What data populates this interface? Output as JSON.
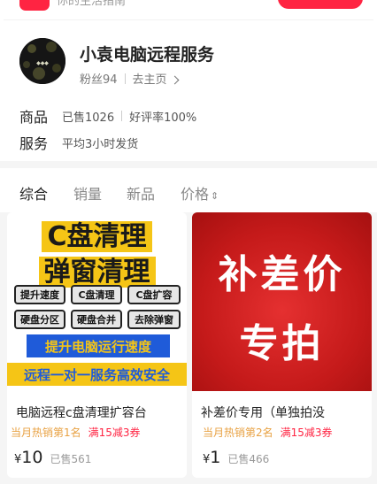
{
  "header": {
    "app_subtitle": "你的生活指南"
  },
  "shop": {
    "name": "小袁电脑远程服务",
    "fans": "粉丝94",
    "home_link": "去主页",
    "rows": [
      {
        "label": "商品",
        "items": [
          "已售1026",
          "好评率100%"
        ]
      },
      {
        "label": "服务",
        "items": [
          "平均3小时发货"
        ]
      }
    ]
  },
  "sort_tabs": [
    {
      "label": "综合",
      "active": true
    },
    {
      "label": "销量",
      "active": false
    },
    {
      "label": "新品",
      "active": false
    },
    {
      "label": "价格",
      "active": false,
      "icon": "sort-updown-icon"
    }
  ],
  "products": [
    {
      "image_text": {
        "line1": "C盘清理",
        "line2": "弹窗清理",
        "pills": [
          "提升速度",
          "C盘清理",
          "C盘扩容",
          "硬盘分区",
          "硬盘合并",
          "去除弹窗"
        ],
        "banner1": "提升电脑运行速度",
        "banner2": "远程一对一服务高效安全"
      },
      "title": "电脑远程c盘清理扩容台",
      "hot_tag": "当月热销第1名",
      "coupon": "满15减3券",
      "currency": "¥",
      "price": "10",
      "sold": "已售561"
    },
    {
      "image_text": {
        "line1": "补差价",
        "line2": "专拍"
      },
      "title": "补差价专用（单独拍没",
      "hot_tag": "当月热销第2名",
      "coupon": "满15减3券",
      "currency": "¥",
      "price": "1",
      "sold": "已售466"
    }
  ],
  "colors": {
    "brand_red": "#ff2442",
    "hot_orange": "#e8a142",
    "banner_blue": "#1f5bd9",
    "banner_yellow": "#f5c516"
  }
}
